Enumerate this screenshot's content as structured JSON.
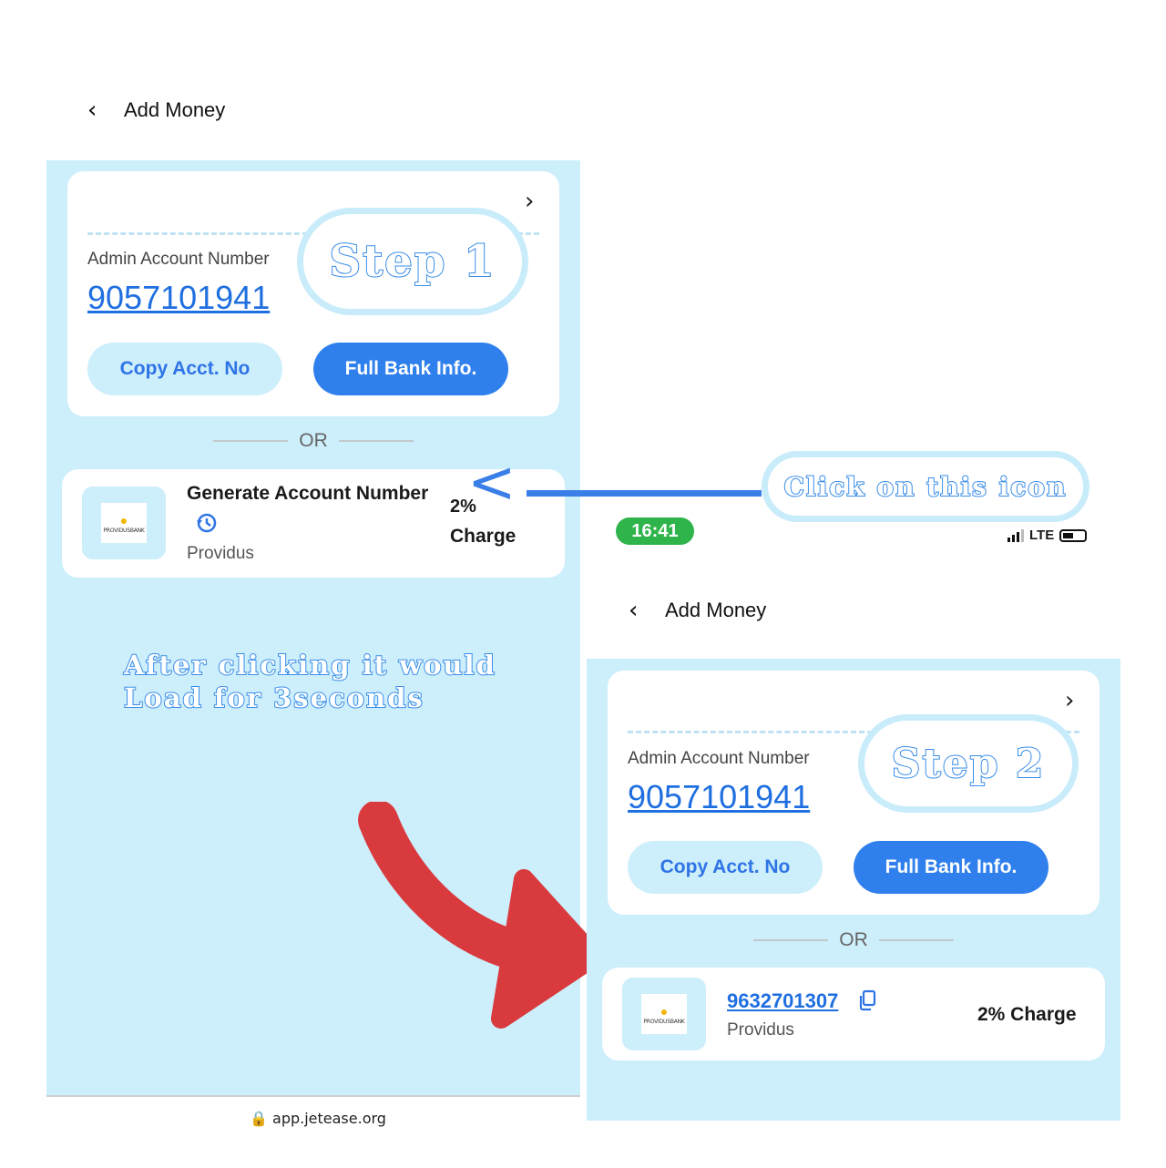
{
  "left": {
    "header": {
      "title": "Add Money"
    },
    "admin_label": "Admin Account Number",
    "admin_number": "9057101941",
    "copy_btn": "Copy Acct. No",
    "full_btn": "Full Bank Info.",
    "or": "OR",
    "generate": {
      "title": "Generate Account Number",
      "bank": "Providus",
      "charge_pct": "2%",
      "charge_word": "Charge"
    },
    "logo_text": "PROVIDUSBANK",
    "url": "app.jetease.org"
  },
  "annotations": {
    "step1": "Step 1",
    "step2": "Step 2",
    "click_icon": "Click on this icon",
    "after_line1": "After clicking it would",
    "after_line2": "Load for 3seconds",
    "arrow_char": "<",
    "arrow_color": "#3a7ee8",
    "big_arrow_color": "#d93a3e"
  },
  "right": {
    "status": {
      "time": "16:41",
      "network": "LTE"
    },
    "header": {
      "title": "Add Money"
    },
    "admin_label": "Admin Account Number",
    "admin_number": "9057101941",
    "copy_btn": "Copy Acct. No",
    "full_btn": "Full Bank Info.",
    "or": "OR",
    "generated": {
      "number": "9632701307",
      "bank": "Providus",
      "charge": "2% Charge"
    },
    "logo_text": "PROVIDUSBANK"
  },
  "colors": {
    "panel_bg": "#cdeefb",
    "accent": "#2f80ed",
    "status_green": "#2fb44b"
  }
}
